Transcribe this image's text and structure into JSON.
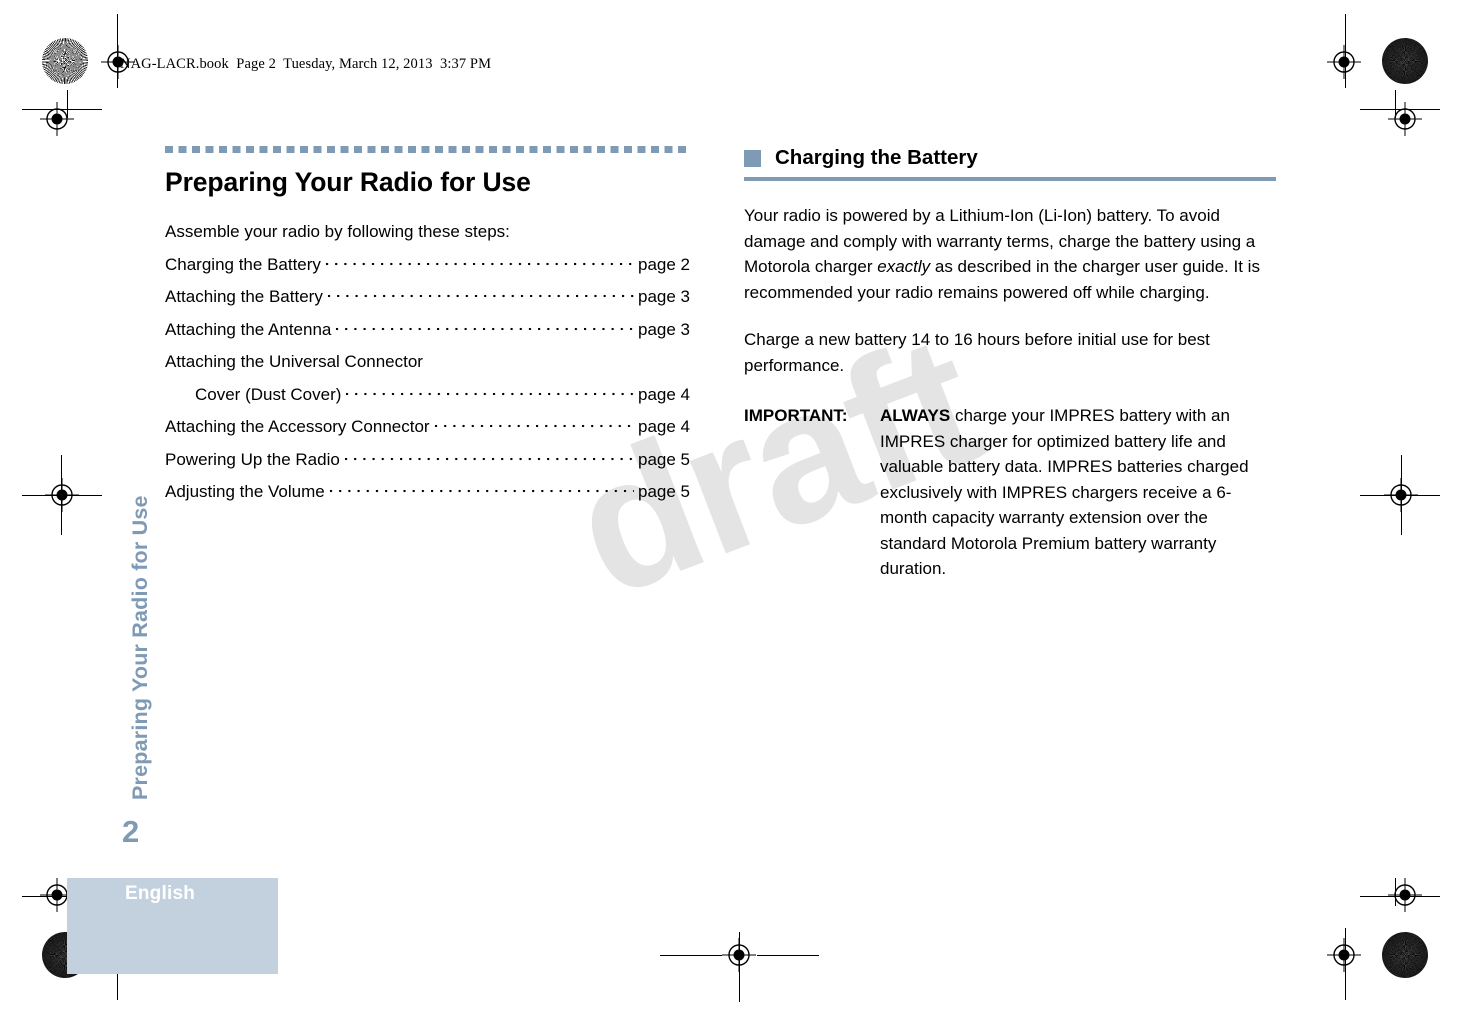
{
  "file_info": "NAG-LACR.book  Page 2  Tuesday, March 12, 2013  3:37 PM",
  "watermark": "draft",
  "sidebar": {
    "running_title": "Preparing Your Radio for Use",
    "page_number": "2",
    "language": "English"
  },
  "left_column": {
    "chapter_title": "Preparing Your Radio for Use",
    "intro": "Assemble your radio by following these steps:",
    "toc": [
      {
        "label": "Charging the Battery",
        "page": "page 2",
        "sub": false,
        "leader": true
      },
      {
        "label": "Attaching the Battery",
        "page": "page 3",
        "sub": false,
        "leader": true
      },
      {
        "label": "Attaching the Antenna",
        "page": "page 3",
        "sub": false,
        "leader": true
      },
      {
        "label": "Attaching the Universal Connector",
        "page": "",
        "sub": false,
        "leader": false
      },
      {
        "label": "Cover (Dust Cover)",
        "page": "page 4",
        "sub": true,
        "leader": true
      },
      {
        "label": "Attaching the Accessory Connector",
        "page": "page 4",
        "sub": false,
        "leader": true
      },
      {
        "label": "Powering Up the Radio",
        "page": "page 5",
        "sub": false,
        "leader": true
      },
      {
        "label": "Adjusting the Volume",
        "page": "page 5",
        "sub": false,
        "leader": true
      }
    ]
  },
  "right_column": {
    "section_title": "Charging the Battery",
    "paragraph_1_part1": "Your radio is powered by a Lithium-Ion (Li-Ion) battery. To avoid damage and comply with warranty terms, charge the battery using a Motorola charger ",
    "paragraph_1_italic": "exactly",
    "paragraph_1_part2": " as described in the charger user guide. It is recommended your radio remains powered off while charging.",
    "paragraph_2": "Charge a new battery 14 to 16 hours before initial use for best performance.",
    "note": {
      "label": "IMPORTANT",
      "label_colon": ":",
      "emphasis": "ALWAYS",
      "text": " charge your IMPRES battery with an IMPRES charger for optimized battery life and valuable battery data. IMPRES batteries charged exclusively with IMPRES chargers receive a 6-month capacity warranty extension over the standard Motorola Premium battery warranty duration."
    }
  },
  "colors": {
    "accent": "#7e9ab5",
    "band": "#c3d1df",
    "watermark": "#e4e4e4"
  }
}
